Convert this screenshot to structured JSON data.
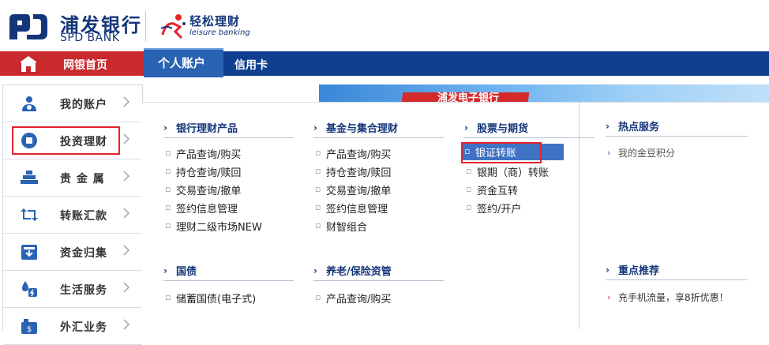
{
  "header": {
    "logo_cn": "浦发银行",
    "logo_en": "SPD BANK",
    "leisure_cn": "轻松理财",
    "leisure_en": "leisure banking"
  },
  "nav": {
    "home": "网银首页",
    "personal": "个人账户",
    "credit": "信用卡"
  },
  "sidebar": {
    "items": [
      {
        "label": "我的账户",
        "icon": "user-icon"
      },
      {
        "label": "投资理财",
        "icon": "investment-icon"
      },
      {
        "label": "贵 金 属",
        "icon": "gold-bars-icon"
      },
      {
        "label": "转账汇款",
        "icon": "transfer-icon"
      },
      {
        "label": "资金归集",
        "icon": "fund-collect-icon"
      },
      {
        "label": "生活服务",
        "icon": "life-service-icon"
      },
      {
        "label": "外汇业务",
        "icon": "forex-icon"
      }
    ]
  },
  "banner": {
    "text": "浦发电子银行"
  },
  "menu": {
    "bank_wealth": {
      "title": "银行理财产品",
      "items": [
        "产品查询/购买",
        "持仓查询/赎回",
        "交易查询/撤单",
        "签约信息管理",
        "理财二级市场NEW"
      ]
    },
    "fund": {
      "title": "基金与集合理财",
      "items": [
        "产品查询/购买",
        "持仓查询/赎回",
        "交易查询/撤单",
        "签约信息管理",
        "财智组合"
      ]
    },
    "stock": {
      "title": "股票与期货",
      "items": [
        "银证转账",
        "银期（商）转账",
        "资金互转",
        "签约/开户"
      ]
    },
    "hot": {
      "title": "热点服务",
      "items": [
        "我的金豆积分"
      ]
    },
    "bond": {
      "title": "国债",
      "items": [
        "储蓄国债(电子式)"
      ]
    },
    "pension": {
      "title": "养老/保险资管",
      "items": [
        "产品查询/购买"
      ]
    },
    "recommend": {
      "title": "重点推荐",
      "items": [
        "充手机流量，享8折优惠！"
      ]
    }
  },
  "colors": {
    "nav_blue": "#0f3f8f",
    "home_red": "#c82a2e",
    "active_tab": "#2a62b4",
    "highlight_red": "#e3232a",
    "selected_blue": "#3f72c4"
  }
}
